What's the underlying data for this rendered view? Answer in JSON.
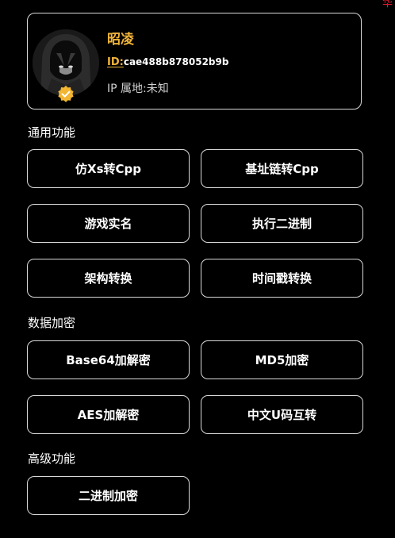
{
  "corner_mark": "华",
  "profile": {
    "name": "昭凌",
    "id_label": "ID:",
    "id_value": "cae488b878052b9b",
    "ip_text": "IP 属地:未知"
  },
  "sections": {
    "general": {
      "title": "通用功能",
      "buttons": [
        "仿Xs转Cpp",
        "基址链转Cpp",
        "游戏实名",
        "执行二进制",
        "架构转换",
        "时间戳转换"
      ]
    },
    "encryption": {
      "title": "数据加密",
      "buttons": [
        "Base64加解密",
        "MD5加密",
        "AES加解密",
        "中文U码互转"
      ]
    },
    "advanced": {
      "title": "高级功能",
      "buttons": [
        "二进制加密"
      ]
    }
  },
  "colors": {
    "background": "#000000",
    "accent": "#f0b43a",
    "border": "#d8d8d8",
    "corner_mark": "#e0192a"
  }
}
